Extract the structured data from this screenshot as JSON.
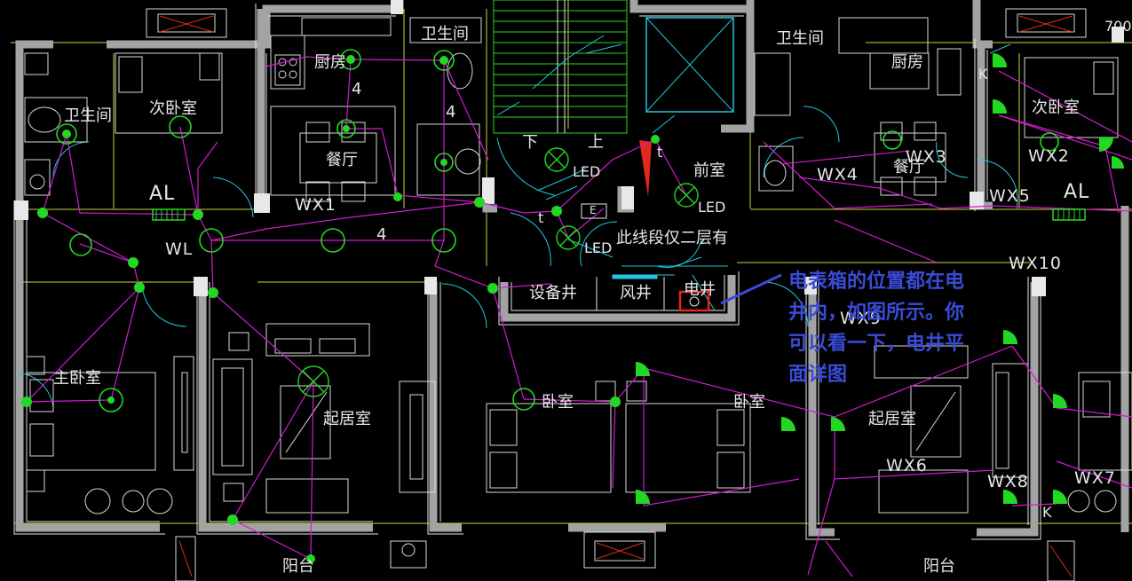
{
  "rooms": {
    "bath_left": "卫生间",
    "kitchen_left": "厨房",
    "bath_center": "卫生间",
    "bath_right": "卫生间",
    "kitchen_right": "厨房",
    "second_bedroom_left": "次卧室",
    "second_bedroom_right": "次卧室",
    "dining_left": "餐厅",
    "dining_right": "餐厅",
    "foyer": "前室",
    "master_bedroom": "主卧室",
    "living_left": "起居室",
    "living_right": "起居室",
    "bedroom_center_left": "卧室",
    "bedroom_center_right": "卧室",
    "balcony_left": "阳台",
    "balcony_right": "阳台",
    "equipment_shaft": "设备井",
    "air_shaft": "风井",
    "electric_shaft": "电井"
  },
  "labels": {
    "stair_down": "下",
    "stair_up": "上",
    "led_1": "LED",
    "led_2": "LED",
    "led_3": "LED",
    "stair_note": "此线段仅二层有",
    "num_4_a": "4",
    "num_4_b": "4",
    "num_4_c": "4",
    "e_box": "E",
    "t_1": "t",
    "t_2": "t",
    "k_1": "K",
    "k_2": "K",
    "dimension": "700"
  },
  "tags": {
    "al_left": "AL",
    "al_right": "AL",
    "wl": "WL",
    "wx1": "WX1",
    "wx2": "WX2",
    "wx3": "WX3",
    "wx4": "WX4",
    "wx5": "WX5",
    "wx6": "WX6",
    "wx7": "WX7",
    "wx8": "WX8",
    "wx9": "WX9",
    "wx10": "WX10"
  },
  "annotation": {
    "line1": "电表箱的位置都在电",
    "line2": "井内，如图所示。你",
    "line3": "可以看一下，电井平",
    "line4": "面详图"
  },
  "colors": {
    "background": "#000000",
    "wall": "#9a9a9a",
    "wall_line": "#e8e8e8",
    "wiring": "#d01ccf",
    "fixture": "#23d823",
    "furniture": "#d8d8d8",
    "cyan": "#22c6e0",
    "yellow_line": "#cfcf40",
    "highlight_box": "#e0281e",
    "annotation": "#3a4bd6"
  }
}
